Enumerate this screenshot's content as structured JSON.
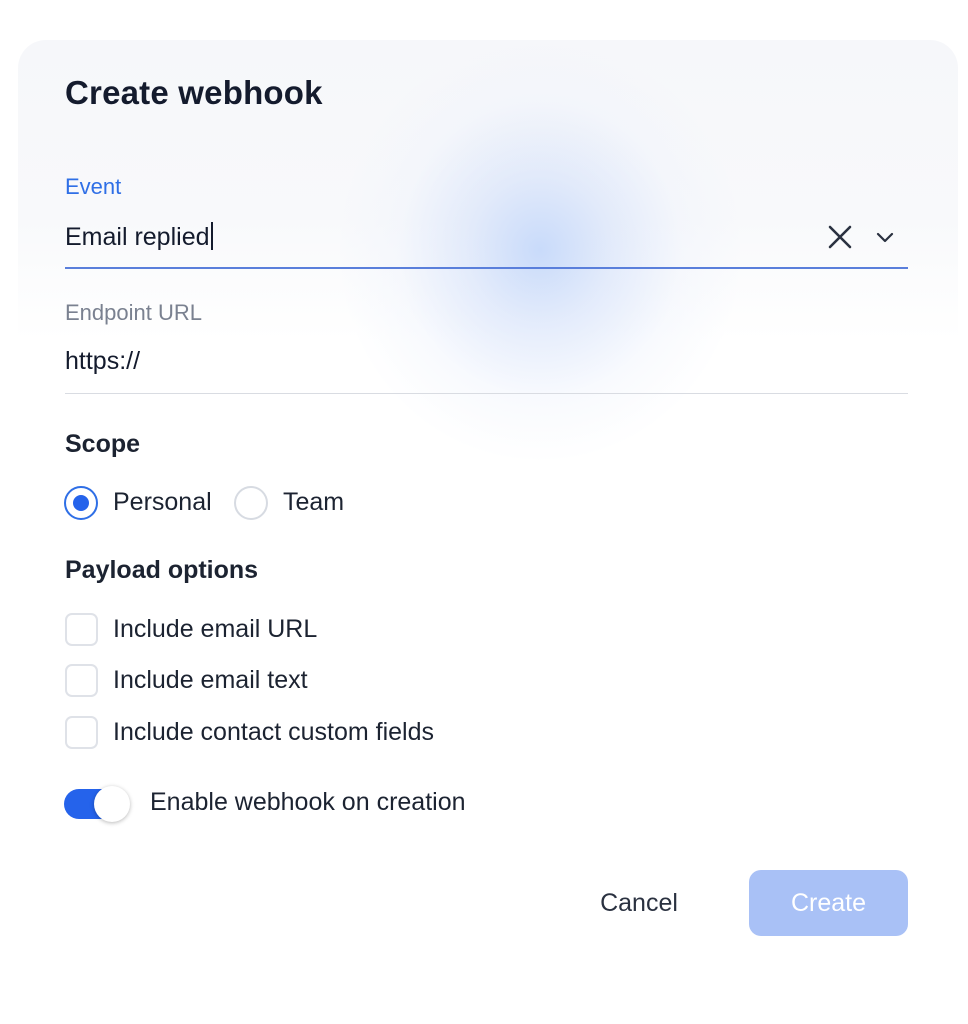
{
  "dialog": {
    "title": "Create webhook"
  },
  "event_field": {
    "label": "Event",
    "value": "Email replied",
    "clear_icon": "close-icon",
    "dropdown_icon": "chevron-down-icon"
  },
  "url_field": {
    "label": "Endpoint URL",
    "value": "https://"
  },
  "scope": {
    "heading": "Scope",
    "options": [
      {
        "label": "Personal",
        "checked": true
      },
      {
        "label": "Team",
        "checked": false
      }
    ]
  },
  "payload": {
    "heading": "Payload options",
    "options": [
      {
        "label": "Include email URL",
        "checked": false
      },
      {
        "label": "Include email text",
        "checked": false
      },
      {
        "label": "Include contact custom fields",
        "checked": false
      }
    ]
  },
  "enable_toggle": {
    "label": "Enable webhook on creation",
    "on": true
  },
  "actions": {
    "cancel_label": "Cancel",
    "create_label": "Create"
  },
  "colors": {
    "accent": "#2563eb",
    "create_disabled": "#a9c1f6",
    "event_label": "#2f6fe6"
  }
}
